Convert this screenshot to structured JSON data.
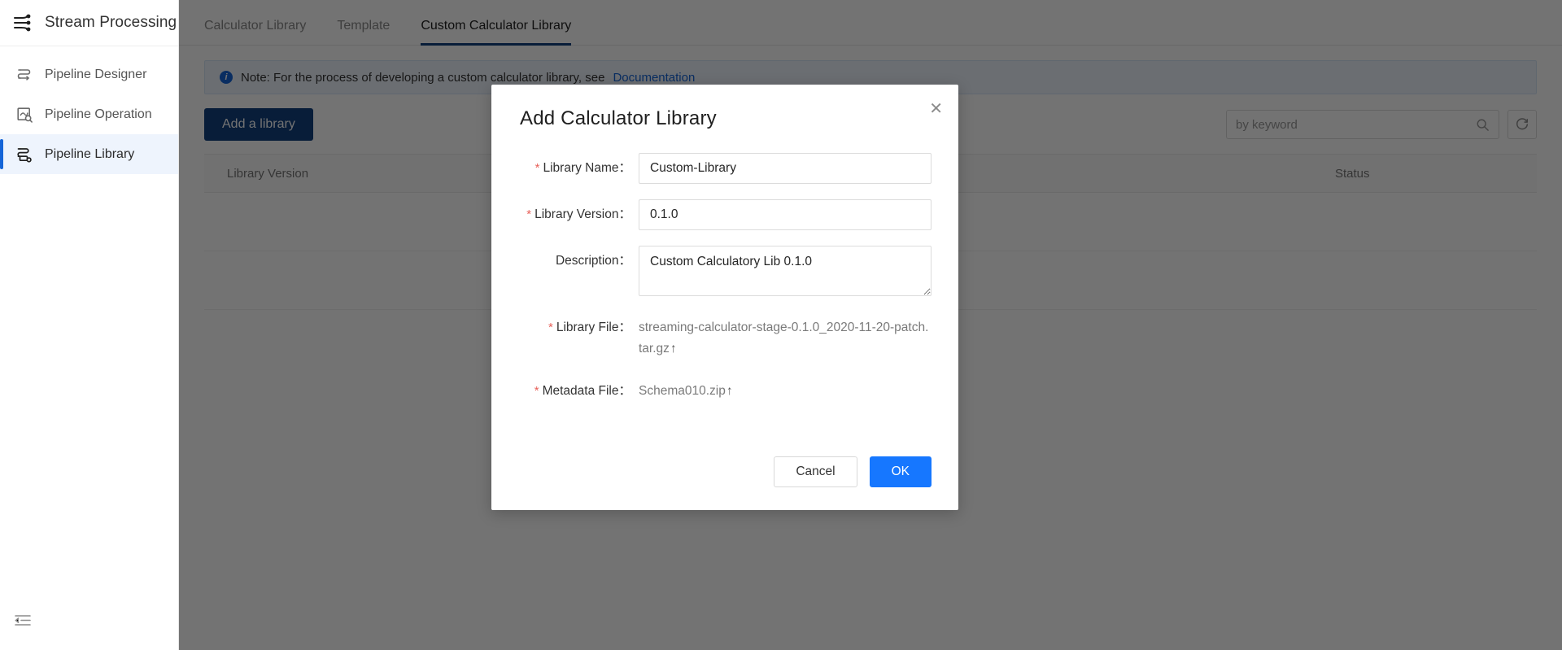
{
  "sidebar": {
    "brand": {
      "title": "Stream Processing",
      "icon": "stream-flow-icon"
    },
    "items": [
      {
        "label": "Pipeline Designer",
        "icon": "pipeline-designer-icon",
        "active": false
      },
      {
        "label": "Pipeline Operation",
        "icon": "pipeline-operation-icon",
        "active": false
      },
      {
        "label": "Pipeline Library",
        "icon": "pipeline-library-icon",
        "active": true
      }
    ],
    "collapse_icon": "collapse-sidebar-icon",
    "active_accent": "#1565d8",
    "active_bg": "#eef4fd"
  },
  "main": {
    "tabs": [
      {
        "label": "Calculator Library",
        "active": false
      },
      {
        "label": "Template",
        "active": false
      },
      {
        "label": "Custom Calculator Library",
        "active": true
      }
    ],
    "tab_underline_color": "#12407f",
    "note": {
      "icon": "info-icon",
      "text": "Note: For the process of developing a custom calculator library, see",
      "link": "Documentation",
      "link_color": "#1565d8"
    },
    "toolbar": {
      "add_library_label": "Add a library",
      "add_library_color": "#12407f",
      "search_placeholder": "by keyword",
      "search_value": "",
      "search_icon": "search-icon",
      "refresh_icon": "refresh-icon"
    },
    "table": {
      "columns": [
        "Library Version",
        "Status"
      ],
      "rows": []
    }
  },
  "modal": {
    "title": "Add Calculator Library",
    "close_icon": "close-icon",
    "fields": [
      {
        "label": "Library Name：",
        "required": true,
        "type": "text",
        "value": "Custom-Library"
      },
      {
        "label": "Library Version：",
        "required": true,
        "type": "text",
        "value": "0.1.0"
      },
      {
        "label": "Description：",
        "required": false,
        "type": "textarea",
        "value": "Custom Calculatory Lib 0.1.0"
      },
      {
        "label": "Library File：",
        "required": true,
        "type": "file",
        "value": "streaming-calculator-stage-0.1.0_2020-11-20-patch.tar.gz",
        "upload_icon": "↑"
      },
      {
        "label": "Metadata File：",
        "required": true,
        "type": "file",
        "value": "Schema010.zip",
        "upload_icon": "↑"
      }
    ],
    "required_marker": "*",
    "required_color": "#e8615a",
    "cancel_label": "Cancel",
    "ok_label": "OK",
    "ok_color": "#1677ff"
  }
}
